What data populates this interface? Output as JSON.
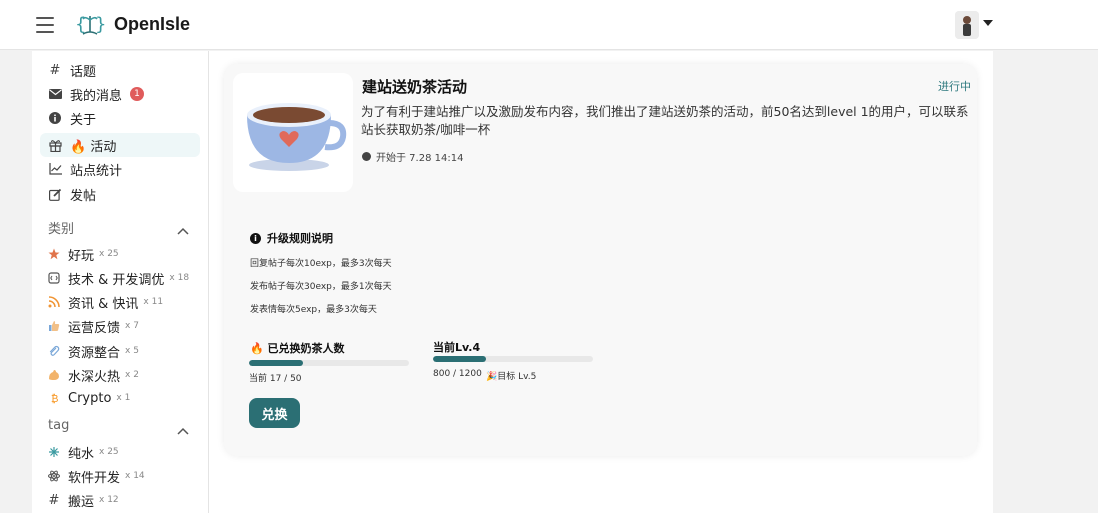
{
  "header": {
    "brand": "OpenIsle",
    "menu_icon": "hamburger-icon",
    "logo_icon": "openisle-logo",
    "avatar_icon": "user-avatar",
    "caret_icon": "caret-down-icon"
  },
  "nav": {
    "items": [
      {
        "icon": "hash-icon",
        "label": "话题"
      },
      {
        "icon": "mail-icon",
        "label": "我的消息",
        "badge": "1"
      },
      {
        "icon": "info-icon",
        "label": "关于"
      },
      {
        "icon": "gift-icon",
        "label": "🔥 活动"
      },
      {
        "icon": "chart-icon",
        "label": "站点统计"
      },
      {
        "icon": "edit-icon",
        "label": "发帖"
      }
    ]
  },
  "categories": {
    "title": "类别",
    "items": [
      {
        "label": "好玩",
        "count": "x 25"
      },
      {
        "label": "技术 & 开发调优",
        "count": "x 18"
      },
      {
        "label": "资讯 & 快讯",
        "count": "x 11"
      },
      {
        "label": "运营反馈",
        "count": "x 7"
      },
      {
        "label": "资源整合",
        "count": "x 5"
      },
      {
        "label": "水深火热",
        "count": "x 2"
      },
      {
        "label": "Crypto",
        "count": "x 1"
      }
    ]
  },
  "tags": {
    "title": "tag",
    "items": [
      {
        "label": "纯水",
        "count": "x 25"
      },
      {
        "label": "软件开发",
        "count": "x 14"
      },
      {
        "label": "搬运",
        "count": "x 12"
      }
    ]
  },
  "activity": {
    "title": "建站送奶茶活动",
    "status": "进行中",
    "description": "为了有利于建站推广以及激励发布内容，我们推出了建站送奶茶的活动，前50名达到level 1的用户，可以联系站长获取奶茶/咖啡一杯",
    "start_time": "开始于 7.28 14:14",
    "image_icon": "tea-cup-image",
    "rules_title": "升级规则说明",
    "rules": [
      "回复帖子每次10exp，最多3次每天",
      "发布帖子每次30exp，最多1次每天",
      "发表情每次5exp，最多3次每天"
    ],
    "redeemed_label": "🔥 已兑换奶茶人数",
    "redeemed_text": "当前 17 / 50",
    "redeemed_progress": 0.34,
    "level_label": "当前Lv.4",
    "level_text": "800 / 1200",
    "level_target": "🎉目标 Lv.5",
    "level_progress": 0.3333,
    "redeem_button": "兑换"
  },
  "colors": {
    "accent": "#2b6f74",
    "badge": "#e05b5b",
    "active_bg": "#eef7f8"
  }
}
